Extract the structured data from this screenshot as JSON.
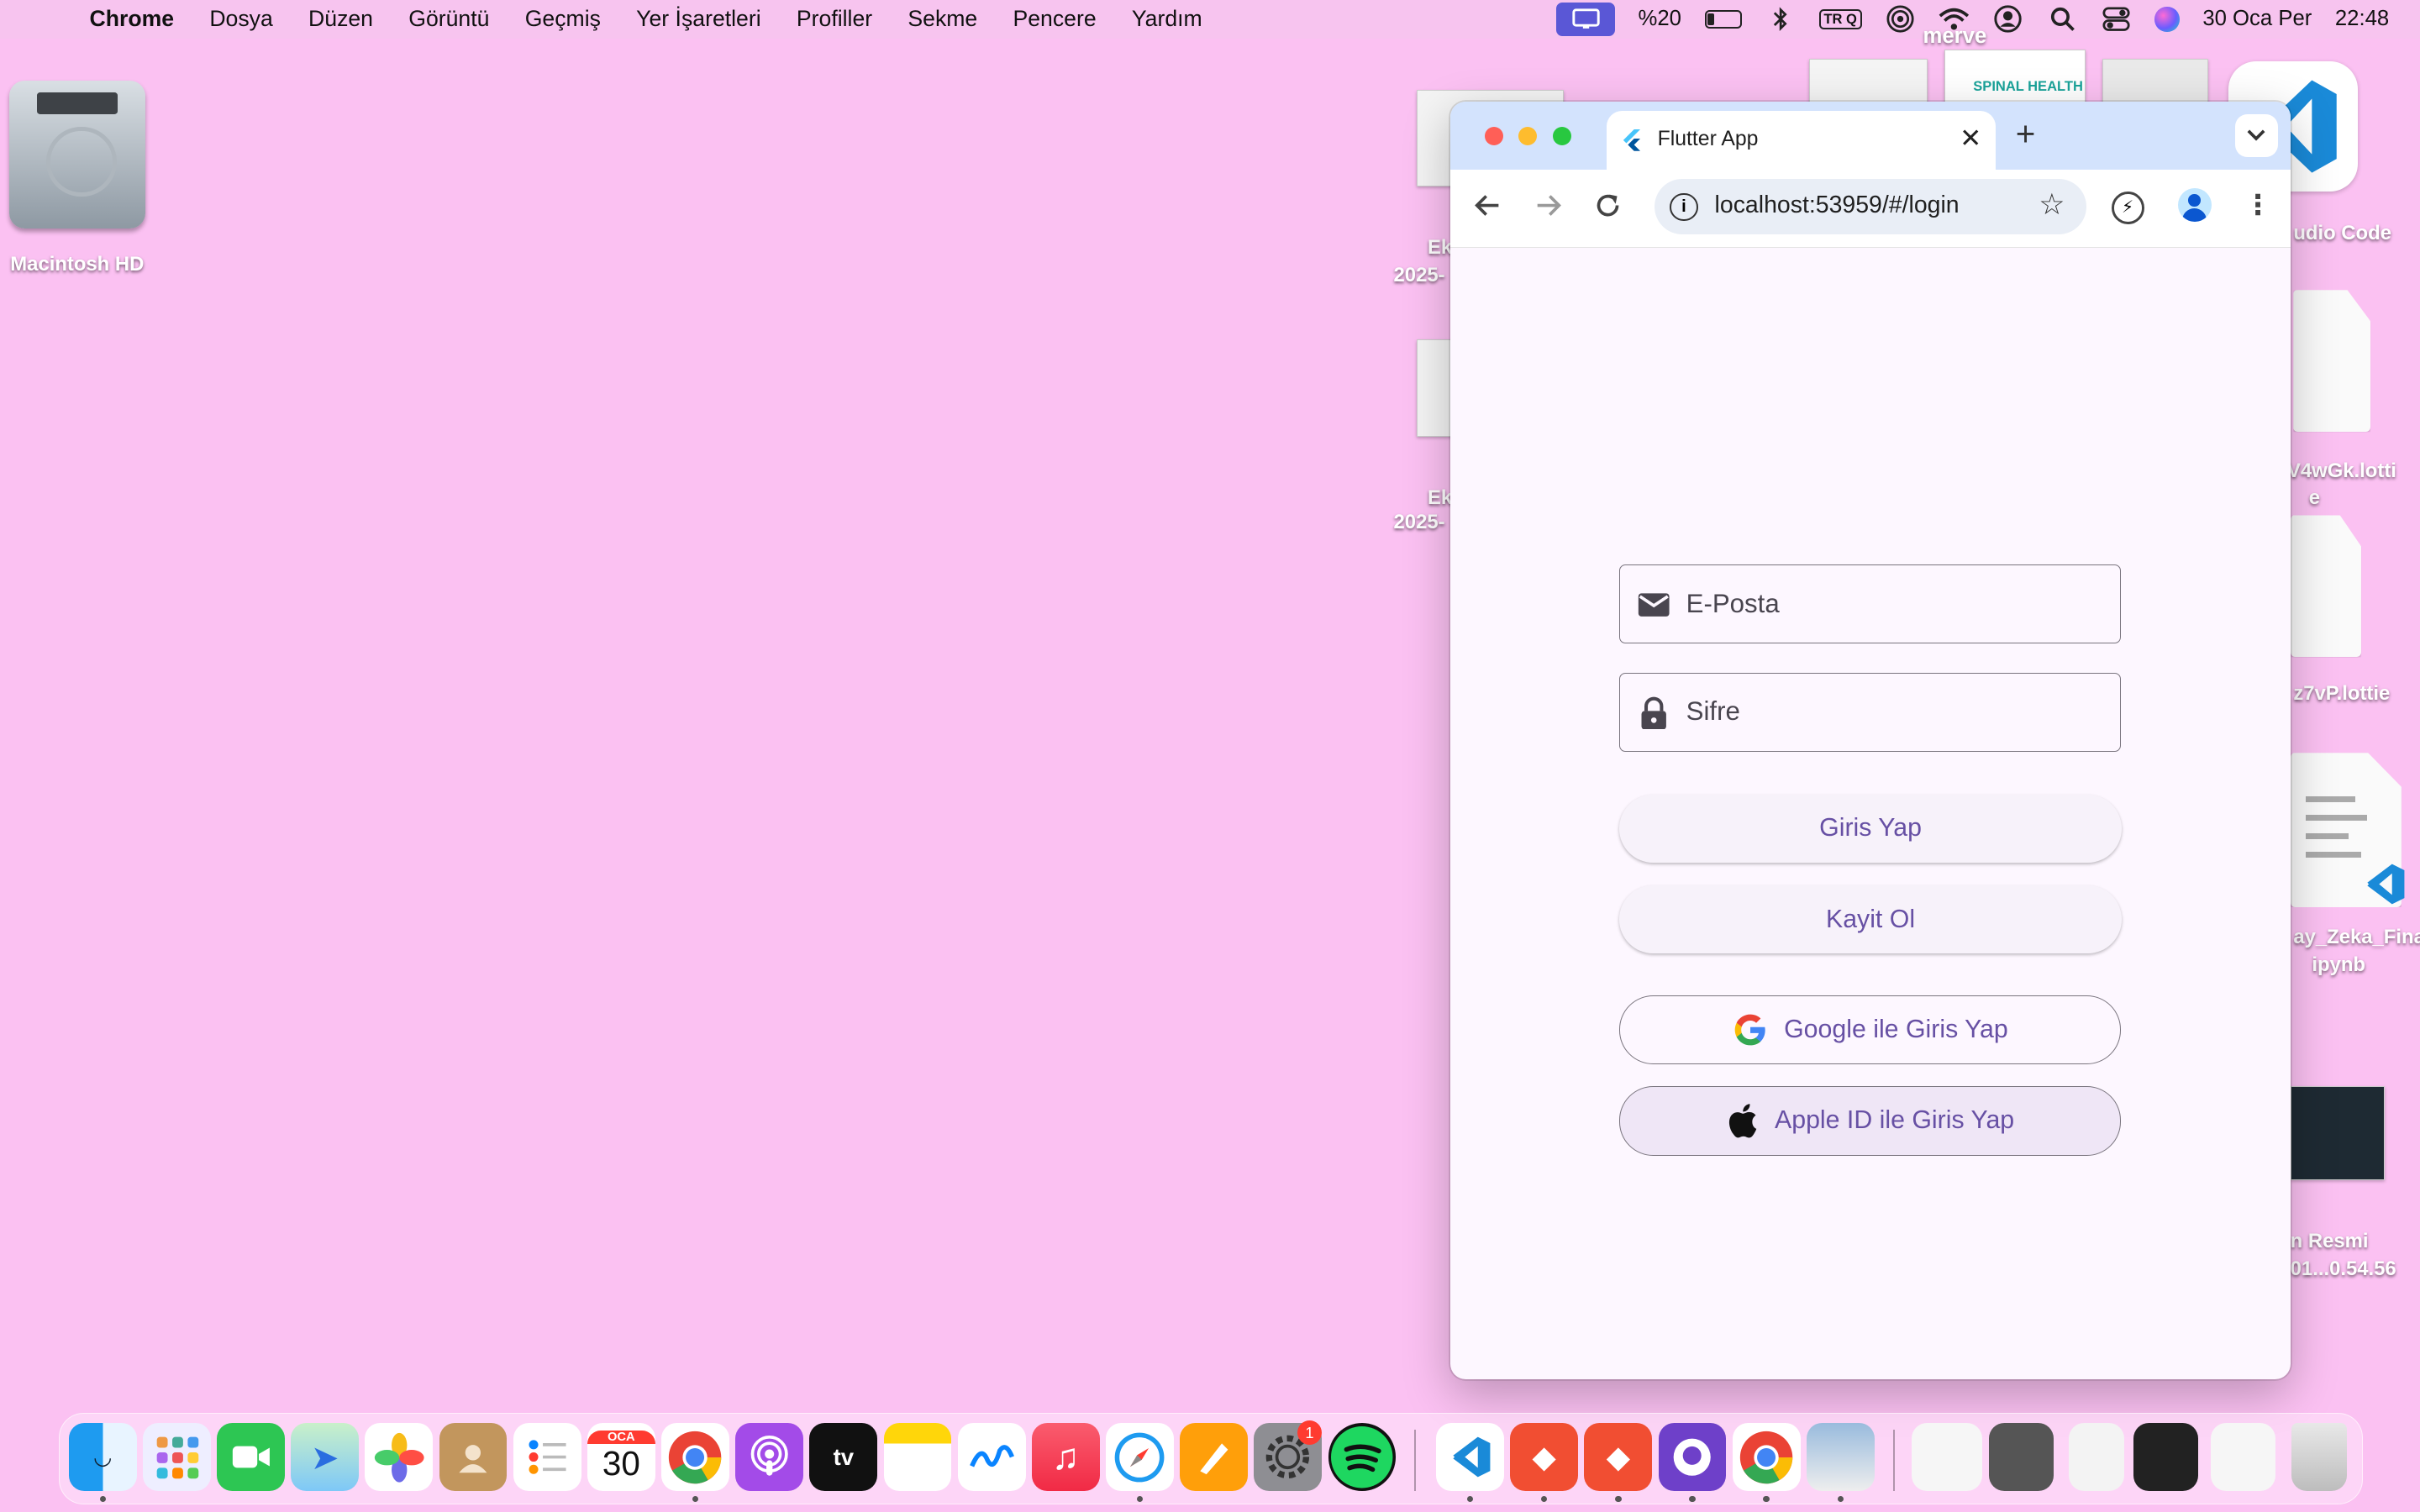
{
  "menubar": {
    "app_name": "Chrome",
    "items": [
      "Dosya",
      "Düzen",
      "Görüntü",
      "Geçmiş",
      "Yer İşaretleri",
      "Profiller",
      "Sekme",
      "Pencere",
      "Yardım"
    ],
    "battery_percent": "%20",
    "battery_level": 0.2,
    "keyboard_layout": "TR Q",
    "date": "30 Oca Per",
    "time": "22:48"
  },
  "desktop": {
    "hd_label": "Macintosh HD",
    "labels": {
      "ek1": "Ek",
      "ek1_sub": "2025-",
      "ek2": "Ek",
      "ek2_sub": "2025-",
      "merve": "merve",
      "spinal": "SPINAL HEALTH",
      "vscode": "udio Code",
      "lottie1_a": "V4wGk.lotti",
      "lottie1_b": "e",
      "lottie2": "z7vP.lottie",
      "ipynb_a": "ay_Zeka_Fina",
      "ipynb_b": "ipynb",
      "resmi_a": "n Resmi",
      "resmi_b": "01...0.54.56"
    }
  },
  "browser": {
    "tab_title": "Flutter App",
    "url": "localhost:53959/#/login",
    "new_tab_symbol": "+",
    "close_symbol": "✕"
  },
  "login": {
    "email_placeholder": "E-Posta",
    "password_placeholder": "Sifre",
    "login_button": "Giris Yap",
    "register_button": "Kayit Ol",
    "google_button": "Google ile Giris Yap",
    "apple_button": "Apple ID ile Giris Yap"
  },
  "dock": {
    "calendar_month": "OCA",
    "calendar_day": "30",
    "settings_badge": "1",
    "tv_label": "tv"
  },
  "colors": {
    "desktop": "#fbc1f2",
    "tabstrip": "#d3e3fd",
    "app_background": "#fdf7ff",
    "primary": "#6750a4",
    "outline": "#79747e"
  }
}
